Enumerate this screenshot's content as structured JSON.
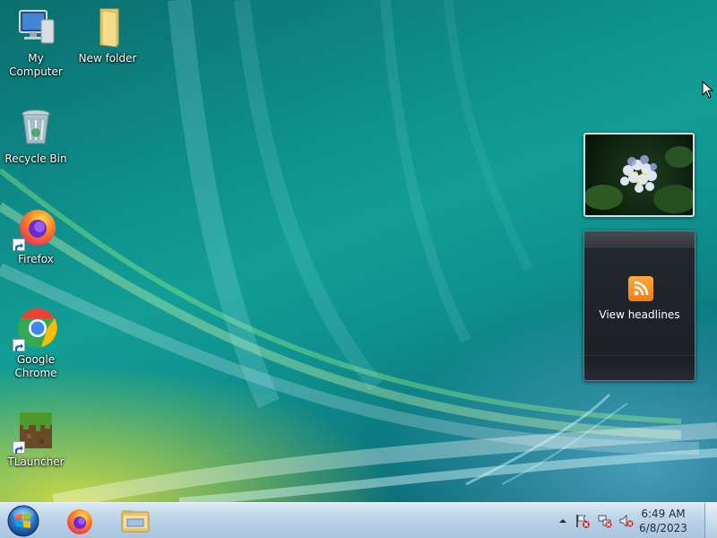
{
  "desktop": {
    "icons": [
      {
        "label": "My Computer",
        "icon": "computer-icon"
      },
      {
        "label": "New folder",
        "icon": "folder-icon"
      },
      {
        "label": "Recycle Bin",
        "icon": "recycle-bin-icon"
      },
      {
        "label": "Firefox",
        "icon": "firefox-icon"
      },
      {
        "label": "Google\nChrome",
        "icon": "chrome-icon"
      },
      {
        "label": "TLauncher",
        "icon": "minecraft-grass-icon"
      }
    ]
  },
  "gadgets": {
    "feed_label": "View headlines",
    "photo_subject": "hydrangea"
  },
  "taskbar": {
    "clock_time": "6:49 AM",
    "clock_date": "6/8/2023"
  },
  "colors": {
    "taskbar": "#bcd3e8",
    "rss_orange": "#f27c12",
    "desktop_teal": "#0e8a88"
  }
}
